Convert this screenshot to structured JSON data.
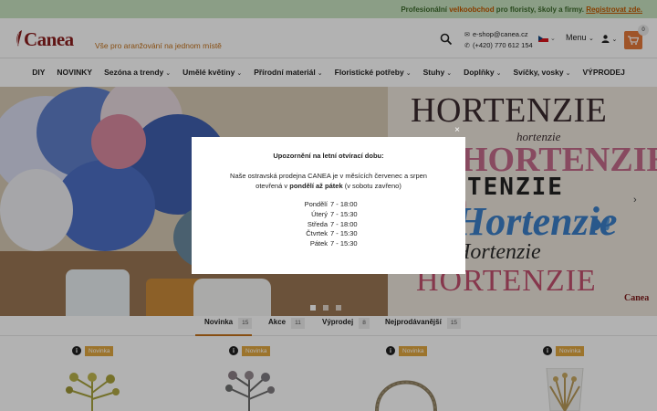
{
  "promo": {
    "part1": "Profesionální ",
    "highlight": "velkoobchod",
    "part2": " pro floristy, školy a firmy. ",
    "link": "Registrovat zde."
  },
  "header": {
    "logo": "Canea",
    "tagline": "Vše pro aranžování na jednom místě",
    "email": "e-shop@canea.cz",
    "phone": "(+420) 770 612 154",
    "menu_label": "Menu",
    "cart_count": "0"
  },
  "nav": {
    "items": [
      {
        "label": "DIY",
        "dropdown": false
      },
      {
        "label": "NOVINKY",
        "dropdown": false
      },
      {
        "label": "Sezóna a trendy",
        "dropdown": true
      },
      {
        "label": "Umělé květiny",
        "dropdown": true
      },
      {
        "label": "Přírodní materiál",
        "dropdown": true
      },
      {
        "label": "Floristické potřeby",
        "dropdown": true
      },
      {
        "label": "Stuhy",
        "dropdown": true
      },
      {
        "label": "Doplňky",
        "dropdown": true
      },
      {
        "label": "Svíčky, vosky",
        "dropdown": true
      },
      {
        "label": "VÝPRODEJ",
        "dropdown": false
      }
    ]
  },
  "hero": {
    "line1": "HORTENZIE",
    "line2": "hortenzie",
    "line3": "HORTENZIE",
    "line4": "TENZIE",
    "line5": "Hortenzie",
    "line6": "Hortenzie",
    "line7": "HORTENZIE",
    "logo": "Canea"
  },
  "tabs": [
    {
      "label": "Novinka",
      "count": "15",
      "active": true
    },
    {
      "label": "Akce",
      "count": "11",
      "active": false
    },
    {
      "label": "Výprodej",
      "count": "8",
      "active": false
    },
    {
      "label": "Nejprodávanější",
      "count": "15",
      "active": false
    }
  ],
  "products": [
    {
      "badge": "Novinka"
    },
    {
      "badge": "Novinka"
    },
    {
      "badge": "Novinka"
    },
    {
      "badge": "Novinka"
    }
  ],
  "modal": {
    "title": "Upozornění na letní otvírací dobu:",
    "text1": "Naše ostravská prodejna CANEA je v měsících červenec a srpen otevřená v ",
    "text_bold": "pondělí až pátek",
    "text2": " (v sobotu zavřeno)",
    "hours": [
      {
        "day": "Pondělí",
        "time": "7 - 18:00"
      },
      {
        "day": "Úterý",
        "time": "7 - 15:30"
      },
      {
        "day": "Středa",
        "time": "7 - 18:00"
      },
      {
        "day": "Čtvrtek",
        "time": "7 - 15:30"
      },
      {
        "day": "Pátek",
        "time": "7 - 15:30"
      }
    ],
    "close": "×"
  },
  "colors": {
    "accent": "#e4793a",
    "brand": "#8a1d1d",
    "badge": "#e0a640"
  }
}
